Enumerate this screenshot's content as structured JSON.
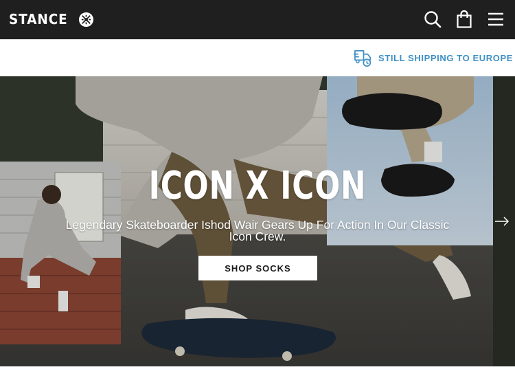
{
  "header": {
    "brand": "STANCE",
    "icons": [
      "search-icon",
      "bag-icon",
      "menu-icon"
    ],
    "background": "#1f1f1f"
  },
  "shipping_banner": {
    "text": "STILL SHIPPING TO EUROPE",
    "icon": "truck-icon",
    "color": "#3f8fc4"
  },
  "hero": {
    "title": "ICON X ICON",
    "subtitle": "Legendary Skateboarder Ishod Wair Gears Up For Action In Our Classic Icon Crew.",
    "cta_label": "SHOP SOCKS",
    "next_icon": "arrow-right-icon"
  }
}
